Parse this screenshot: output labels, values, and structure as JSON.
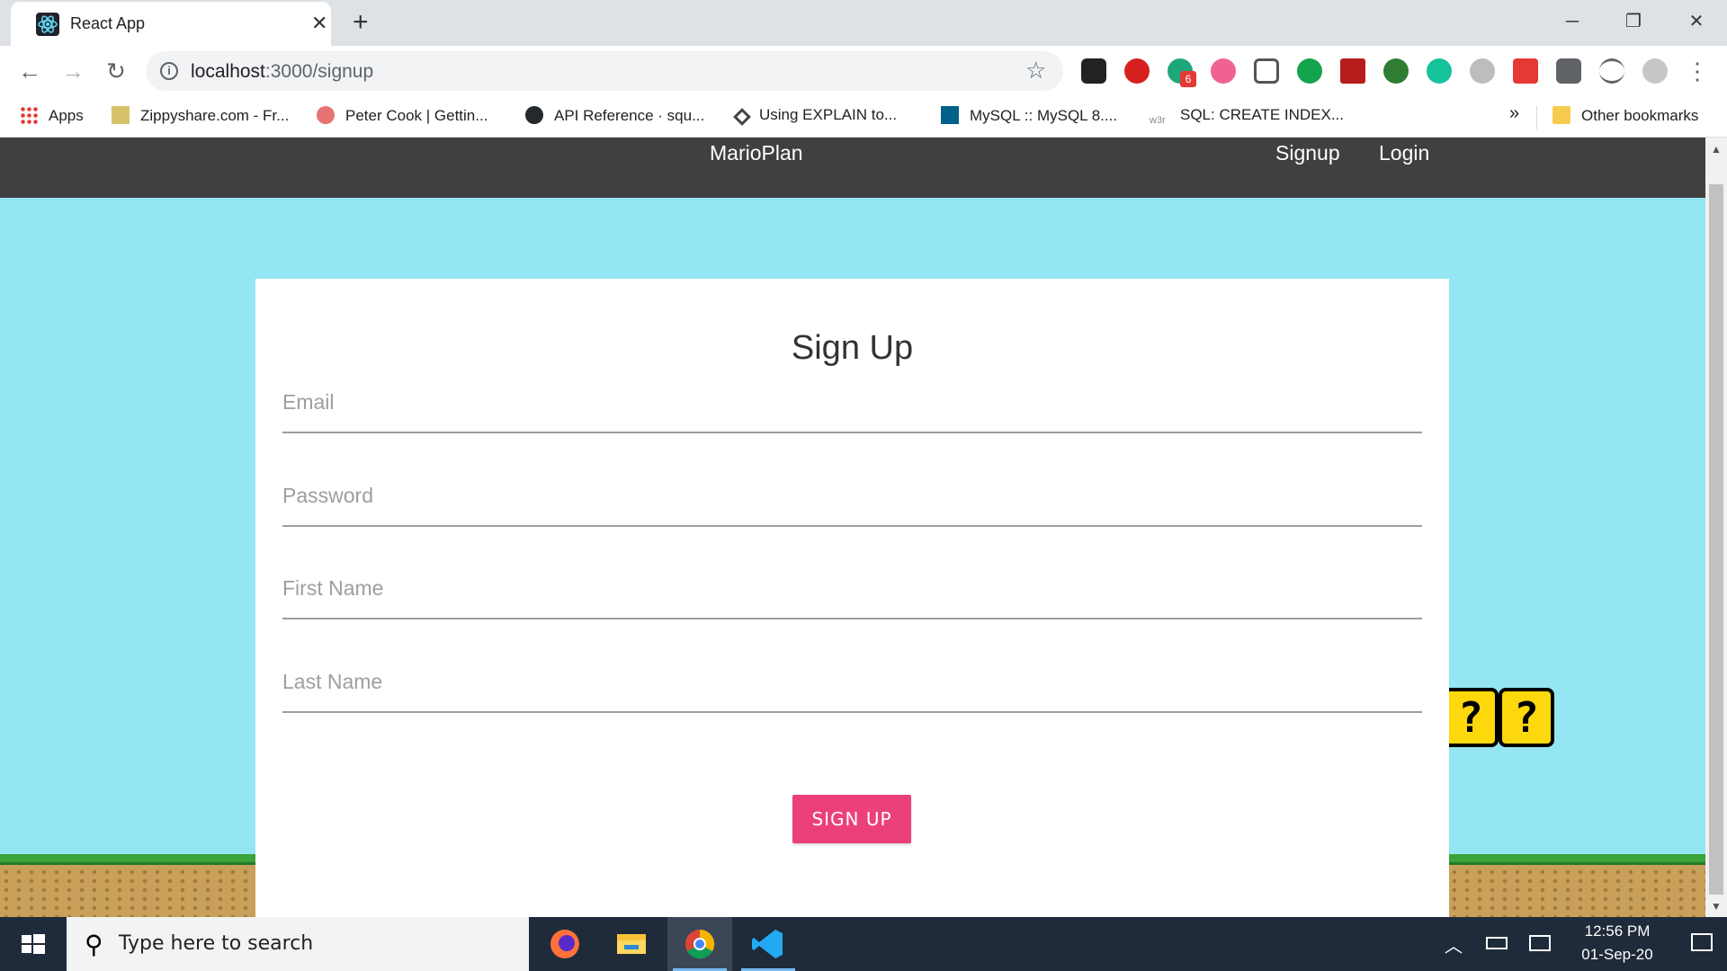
{
  "browser": {
    "tab_title": "React App",
    "new_tab": "+",
    "close_tab": "✕",
    "url_host": "localhost",
    "url_path": ":3000/signup",
    "bookmarks": [
      "Apps",
      "Zippyshare.com - Fr...",
      "Peter Cook | Gettin...",
      "API Reference · squ...",
      "Using EXPLAIN to...",
      "MySQL :: MySQL 8....",
      "SQL: CREATE INDEX..."
    ],
    "bookmarks_overflow": "»",
    "other_bookmarks": "Other bookmarks",
    "extension_badge": "6"
  },
  "app": {
    "brand": "MarioPlan",
    "nav": {
      "signup": "Signup",
      "login": "Login"
    },
    "form": {
      "title": "Sign Up",
      "fields": [
        "Email",
        "Password",
        "First Name",
        "Last Name"
      ],
      "submit": "SIGN UP"
    },
    "blocks": [
      "?",
      "?"
    ]
  },
  "taskbar": {
    "search_placeholder": "Type here to search",
    "time": "12:56 PM",
    "date": "01-Sep-20"
  },
  "colors": {
    "page_background": "#94e6f2",
    "navbar": "#404040",
    "accent_button": "#ec407a"
  }
}
